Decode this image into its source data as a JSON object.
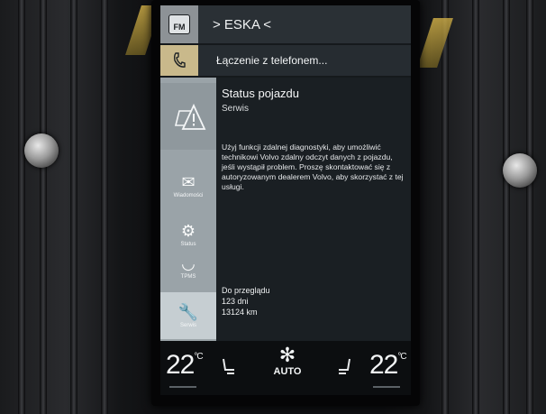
{
  "radio": {
    "band_label": "FM",
    "station_label": "> ESKA <",
    "icon": "radio-icon"
  },
  "phone": {
    "label": "Łączenie z telefonem...",
    "icon": "phone-icon"
  },
  "sidebar": {
    "warning_icon": "car-warning-icon",
    "items": [
      {
        "label": "Wiadomości",
        "icon": "message-icon"
      },
      {
        "label": "Status",
        "icon": "car-status-icon"
      },
      {
        "label": "TPMS",
        "icon": "tire-icon"
      },
      {
        "label": "Serwis",
        "icon": "wrench-icon"
      }
    ]
  },
  "content": {
    "title": "Status pojazdu",
    "subtitle": "Serwis",
    "body": "Użyj funkcji zdalnej diagnostyki, aby umożliwić technikowi Volvo zdalny odczyt danych z pojazdu, jeśli wystąpił problem. Proszę skontaktować się z autoryzowanym dealerem Volvo, aby skorzystać z tej usługi.",
    "due_label": "Do przeglądu",
    "due_days": "123 dni",
    "due_km": "13124 km"
  },
  "climate": {
    "left_temp": "22",
    "right_temp": "22",
    "unit": "°C",
    "fan_label": "AUTO",
    "fan_icon": "fan-auto-icon",
    "seat_left_icon": "seat-heat-left-icon",
    "seat_right_icon": "seat-heat-right-icon"
  }
}
